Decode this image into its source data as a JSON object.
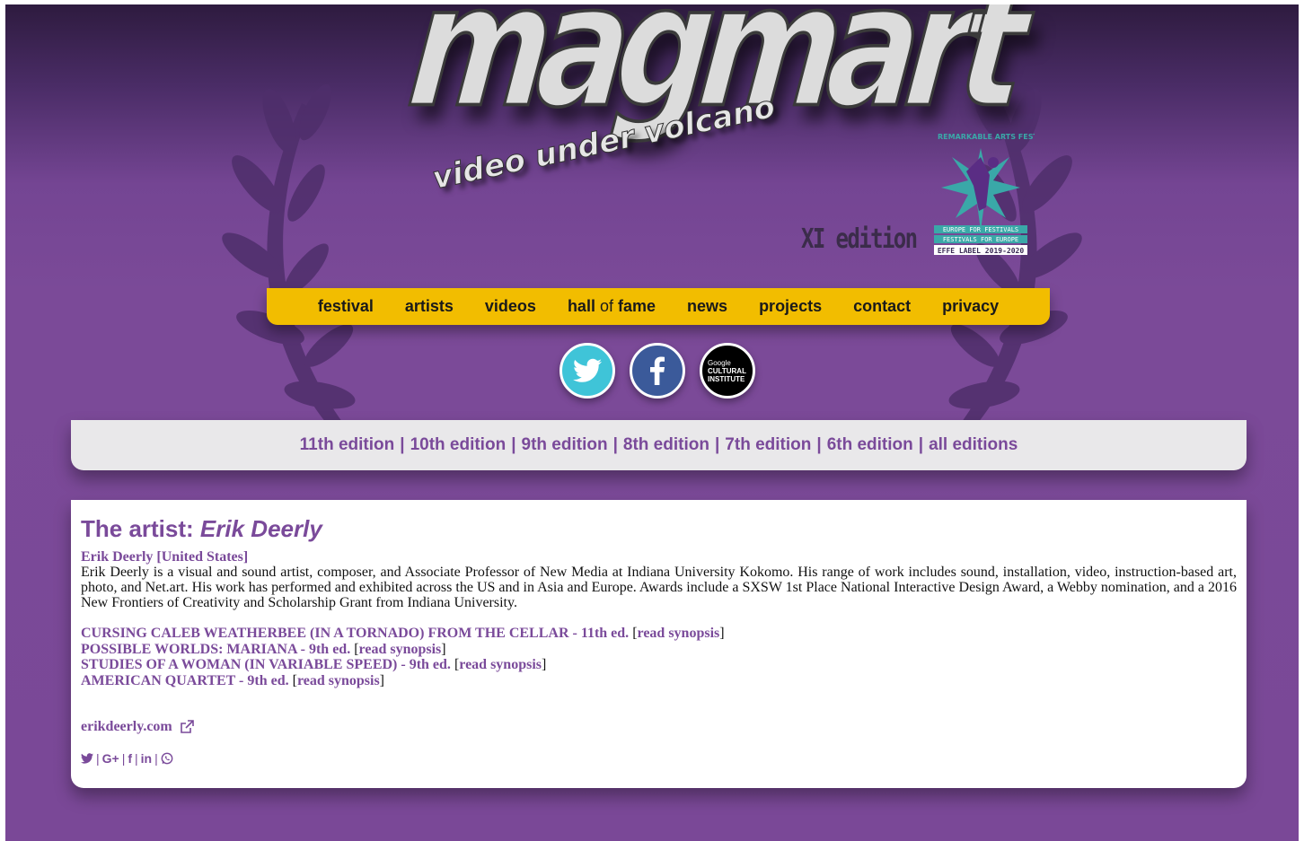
{
  "brand": {
    "logo_word": "magmart",
    "logo_tagline": "video under volcano",
    "edition_label": "XI edition",
    "effe_badge": {
      "arc_text": "REMARKABLE ARTS FESTIVAL",
      "line1": "EUROPE FOR FESTIVALS",
      "line2": "FESTIVALS FOR EUROPE",
      "line3": "EFFE LABEL 2019-2020"
    }
  },
  "nav": {
    "festival": "festival",
    "artists": "artists",
    "videos": "videos",
    "hall": "hall",
    "of": "of",
    "fame": "fame",
    "news": "news",
    "projects": "projects",
    "contact": "contact",
    "privacy": "privacy"
  },
  "social": {
    "twitter_icon": "twitter-icon",
    "facebook_icon": "facebook-icon",
    "gci_line1": "Google",
    "gci_line2": "CULTURAL",
    "gci_line3": "INSTITUTE"
  },
  "editions": {
    "separator": "|",
    "items": [
      "11th edition",
      "10th edition",
      "9th edition",
      "8th edition",
      "7th edition",
      "6th edition",
      "all editions"
    ]
  },
  "artist": {
    "heading_prefix": "The artist: ",
    "heading_name": "Erik Deerly",
    "name_country": "Erik Deerly [United States]",
    "bio": "Erik Deerly is a visual and sound artist, composer, and Associate Professor of New Media at Indiana University Kokomo. His range of work includes sound, installation, video, instruction-based art, photo, and Net.art. His work has performed and exhibited across the US and in Asia and Europe. Awards include a SXSW 1st Place National Interactive Design Award, a Webby nomination, and a 2016 New Frontiers of Creativity and Scholarship Grant from Indiana University.",
    "works": [
      {
        "title": "CURSING CALEB WEATHERBEE (IN A TORNADO) FROM THE CELLAR - 11th ed.",
        "link": "read synopsis"
      },
      {
        "title": "POSSIBLE WORLDS: MARIANA - 9th ed.",
        "link": "read synopsis"
      },
      {
        "title": "STUDIES OF A WOMAN (IN VARIABLE SPEED) - 9th ed.",
        "link": "read synopsis"
      },
      {
        "title": "AMERICAN QUARTET - 9th ed.",
        "link": "read synopsis"
      }
    ],
    "website": "erikdeerly.com",
    "share": {
      "twitter": "twitter-icon",
      "googleplus": "G+",
      "facebook": "f",
      "linkedin": "in",
      "whatsapp": "whatsapp-icon",
      "separator": "|"
    }
  },
  "colors": {
    "background_purple": "#7a4897",
    "nav_yellow": "#f2bd00",
    "link_purple": "#7a4a9a",
    "editions_bar": "#e9e8ea"
  }
}
